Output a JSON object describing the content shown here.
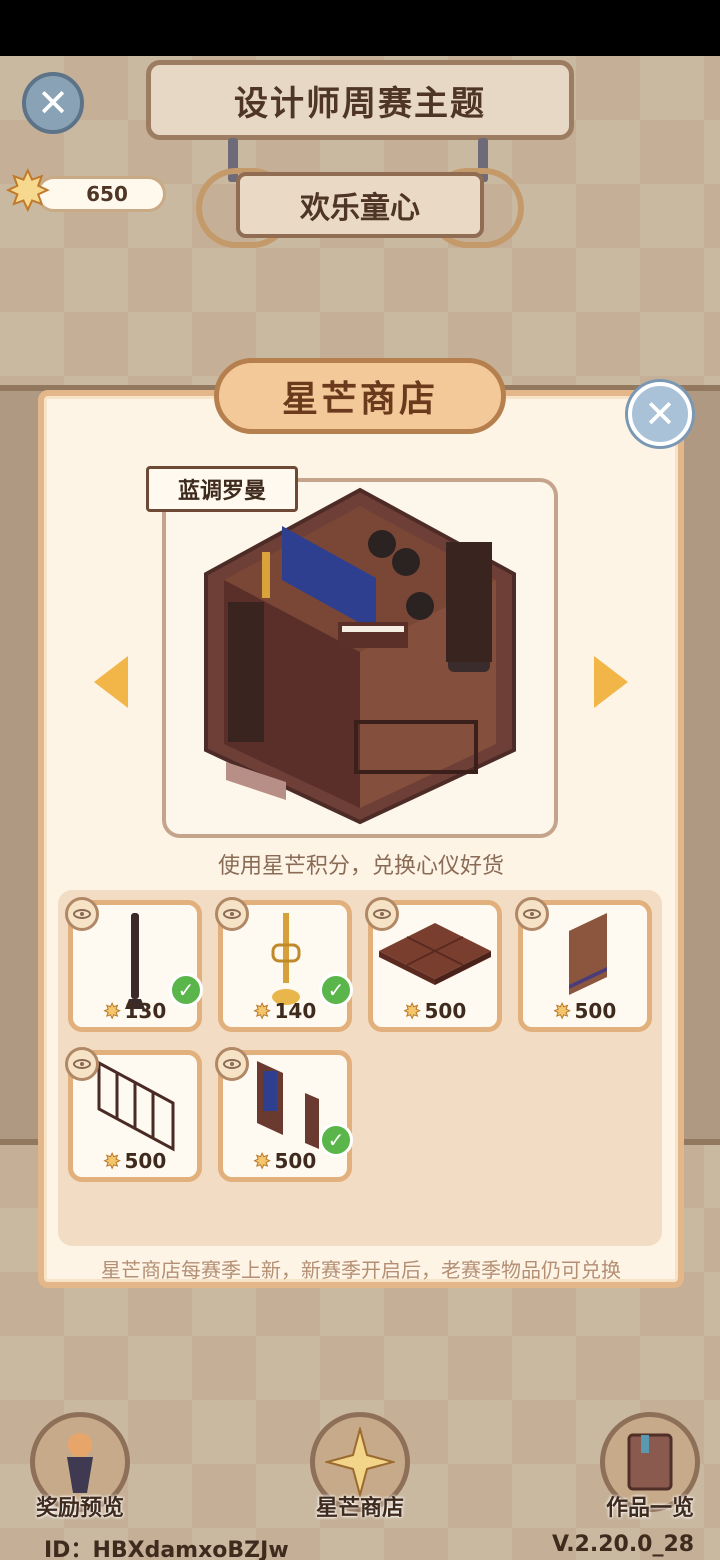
{
  "header": {
    "title": "设计师周赛主题",
    "theme": "欢乐童心",
    "points": "650"
  },
  "shop": {
    "title": "星芒商店",
    "featured_name": "蓝调罗曼",
    "subtitle": "使用星芒积分，兑换心仪好货",
    "footnote": "星芒商店每赛季上新，新赛季开启后，老赛季物品仍可兑换",
    "items": [
      {
        "name": "clarinet",
        "price": "130",
        "owned": true
      },
      {
        "name": "trumpet",
        "price": "140",
        "owned": true
      },
      {
        "name": "floor-tile",
        "price": "500",
        "owned": false
      },
      {
        "name": "wall-panel",
        "price": "500",
        "owned": false
      },
      {
        "name": "railing",
        "price": "500",
        "owned": false
      },
      {
        "name": "window-shelf",
        "price": "500",
        "owned": true
      }
    ]
  },
  "nav": {
    "rewards": "奖励预览",
    "shop": "星芒商店",
    "works": "作品一览"
  },
  "footer": {
    "id": "ID：HBXdamxoBZJw",
    "version": "V.2.20.0_28"
  },
  "colors": {
    "accent": "#f2b548",
    "panel_border": "#e4b78a",
    "owned_check": "#5ab54a"
  }
}
